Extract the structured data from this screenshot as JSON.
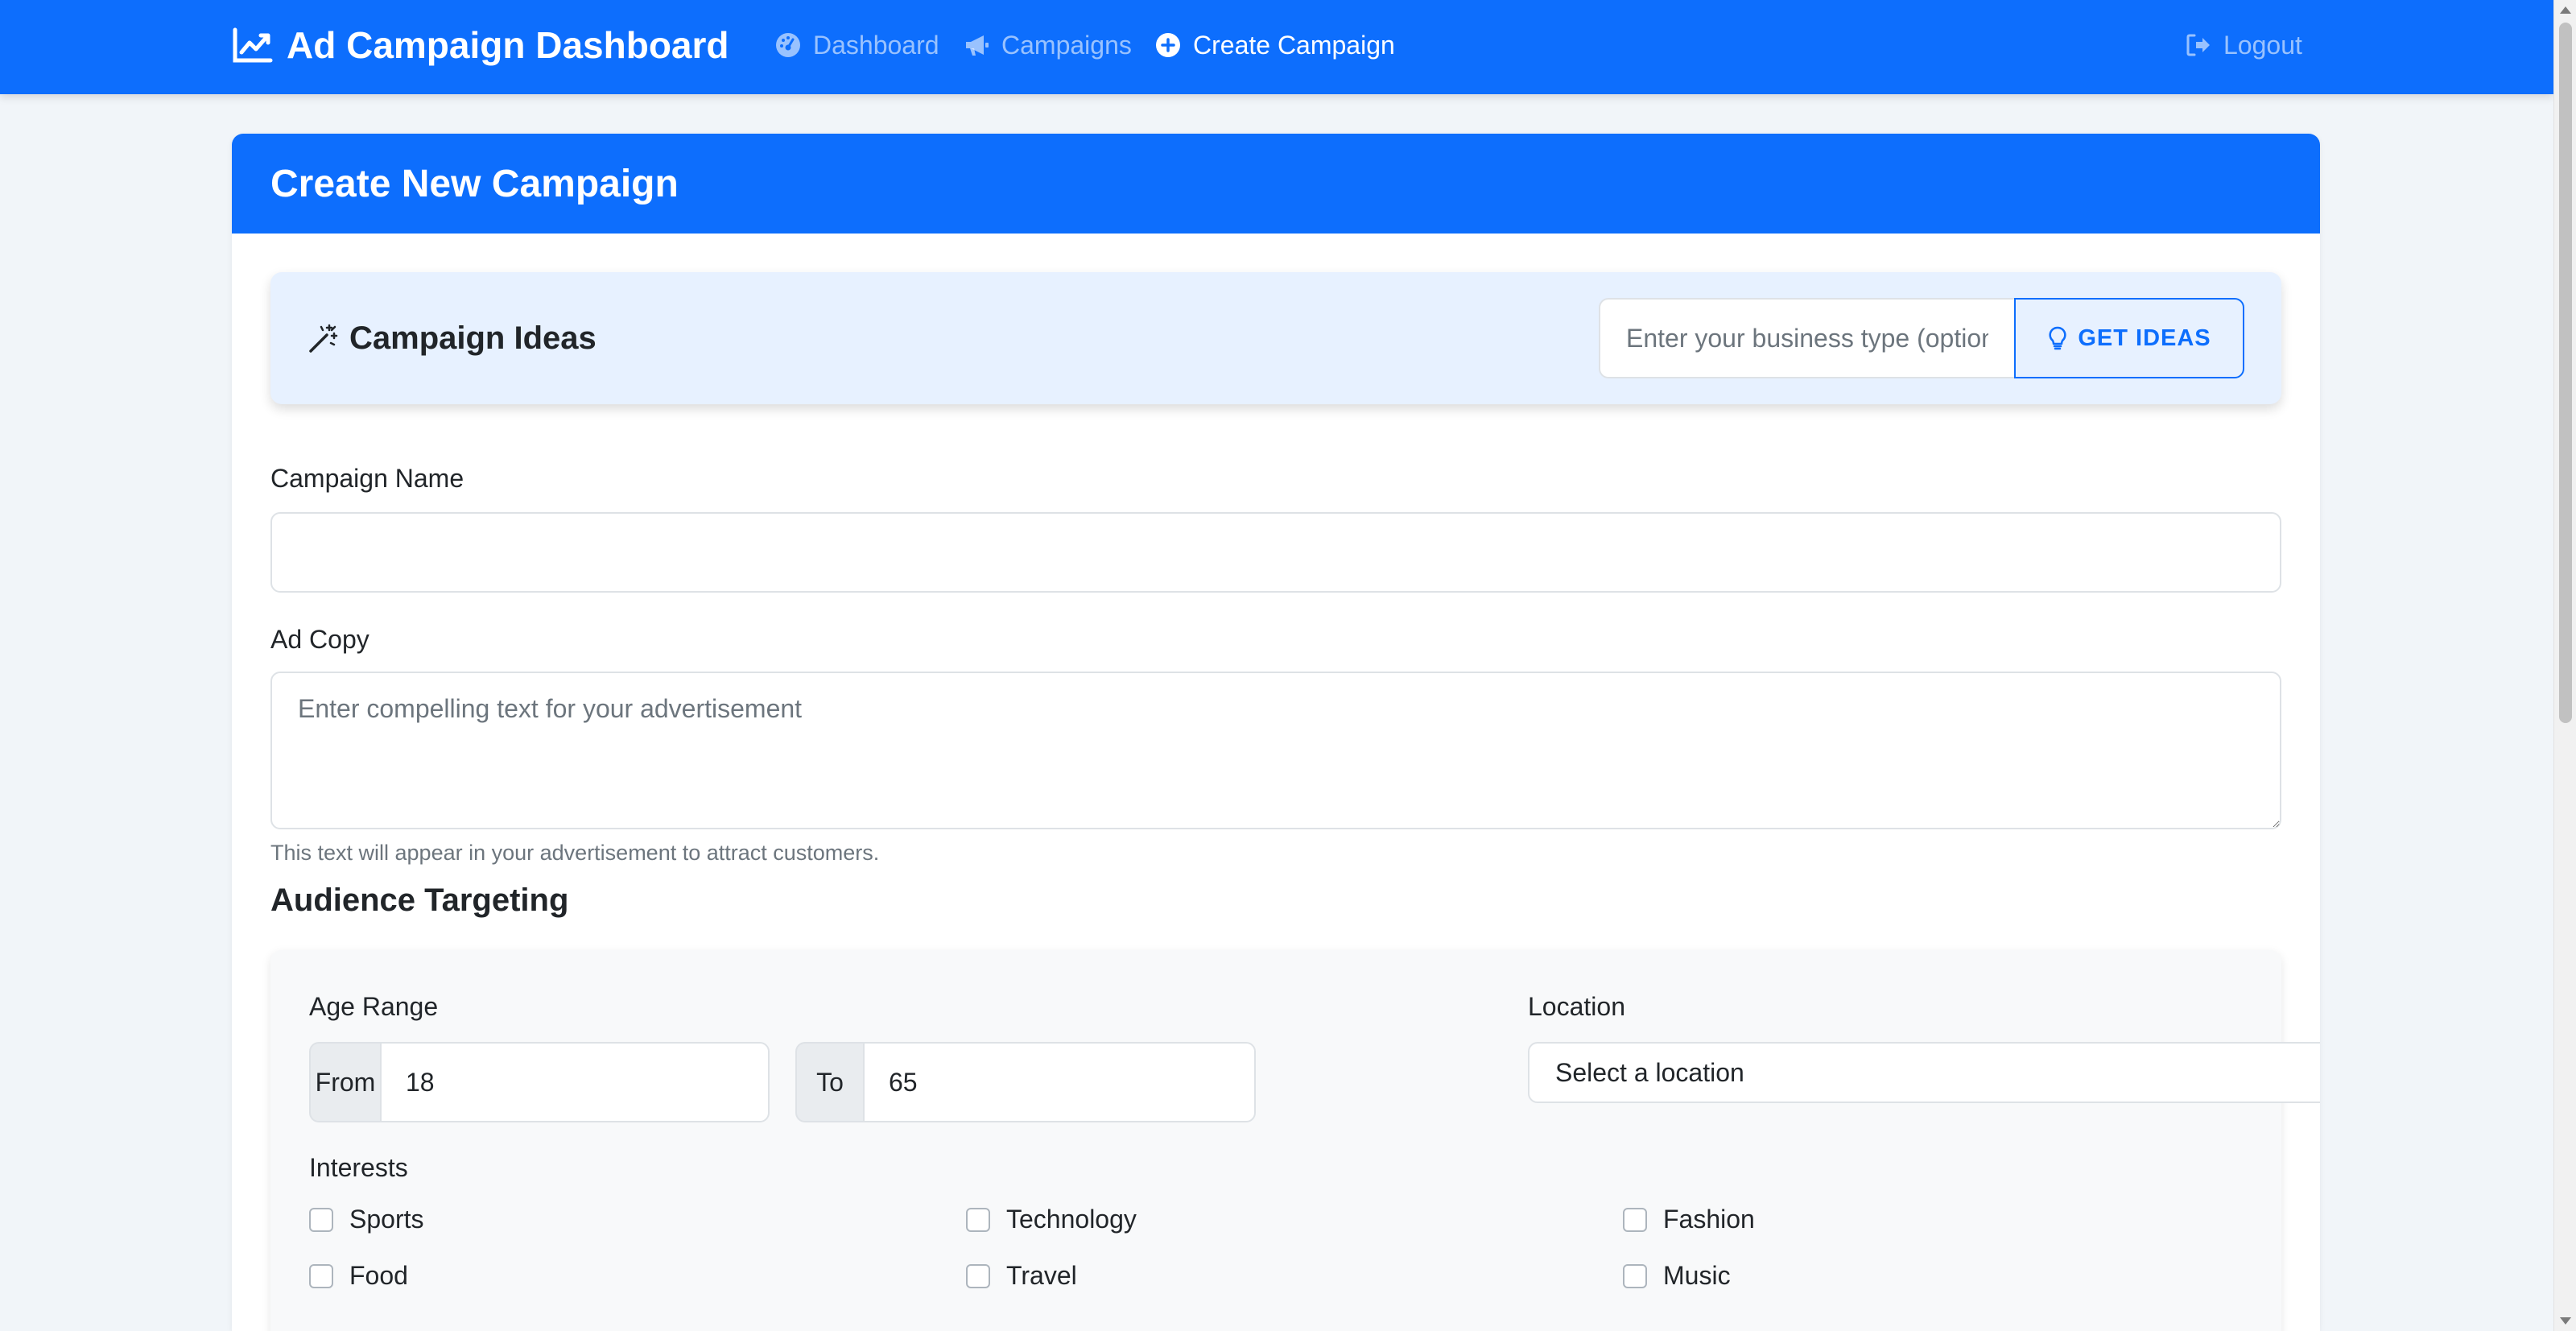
{
  "navbar": {
    "brand": "Ad Campaign Dashboard",
    "brand_icon": "chart-line-icon",
    "links": [
      {
        "label": "Dashboard",
        "icon": "gauge-icon",
        "active": false
      },
      {
        "label": "Campaigns",
        "icon": "megaphone-icon",
        "active": false
      },
      {
        "label": "Create Campaign",
        "icon": "plus-circle-icon",
        "active": true
      }
    ],
    "logout": {
      "label": "Logout",
      "icon": "sign-out-icon"
    }
  },
  "card": {
    "title": "Create New Campaign"
  },
  "ideas": {
    "title": "Campaign Ideas",
    "icon": "magic-wand-icon",
    "input_placeholder": "Enter your business type (optional)",
    "button_label": "GET IDEAS",
    "button_icon": "lightbulb-icon"
  },
  "form": {
    "campaign_name_label": "Campaign Name",
    "campaign_name_value": "",
    "ad_copy_label": "Ad Copy",
    "ad_copy_placeholder": "Enter compelling text for your advertisement",
    "ad_copy_help": "This text will appear in your advertisement to attract customers."
  },
  "audience": {
    "section_title": "Audience Targeting",
    "age_range_label": "Age Range",
    "from_label": "From",
    "from_value": "18",
    "to_label": "To",
    "to_value": "65",
    "location_label": "Location",
    "location_selected": "Select a location",
    "interests_label": "Interests",
    "interests": [
      {
        "label": "Sports",
        "checked": false
      },
      {
        "label": "Technology",
        "checked": false
      },
      {
        "label": "Fashion",
        "checked": false
      },
      {
        "label": "Food",
        "checked": false
      },
      {
        "label": "Travel",
        "checked": false
      },
      {
        "label": "Music",
        "checked": false
      }
    ]
  },
  "colors": {
    "primary": "#0d6efd",
    "ideas_bg": "#e7f1ff",
    "page_bg": "#f1f5f9"
  }
}
